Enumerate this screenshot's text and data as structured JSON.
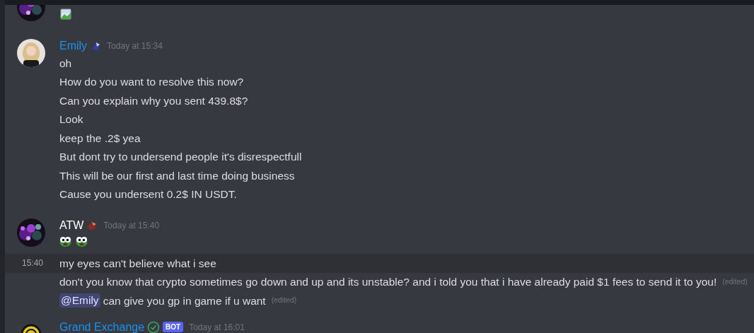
{
  "messages": [
    {
      "kind": "image"
    },
    {
      "kind": "group",
      "author": "Emily",
      "color": "#1a91f0",
      "time": "Today at 15:34",
      "lines": [
        {
          "text": "oh",
          "edited": false
        },
        {
          "text": "How do you want to resolve this now?",
          "edited": false
        },
        {
          "text": "Can you explain why you sent 439.8$?",
          "edited": false
        },
        {
          "text": "Look",
          "edited": false
        },
        {
          "text": "keep the .2$ yea",
          "edited": false
        },
        {
          "text": "But dont try to undersend people it's disrespectfull",
          "edited": false
        },
        {
          "text": "This will be our first and last time doing business",
          "edited": false
        },
        {
          "text": "Cause you undersent 0.2$ IN USDT.",
          "edited": false
        }
      ]
    },
    {
      "kind": "group",
      "author": "ATW",
      "color": "#ffffff",
      "time": "Today at 15:40",
      "emojis": [
        {
          "kind": "frog"
        },
        {
          "kind": "frog"
        }
      ]
    },
    {
      "kind": "continuation",
      "hovered": true,
      "time": "15:40",
      "lines": [
        {
          "text": "my eyes can't believe what i see",
          "edited": false
        },
        {
          "text": "don't you know that crypto sometimes go down and up and its unstable? and i told you that i have already paid $1 fees to send it to you!",
          "edited": true,
          "edited_label": "(edited)"
        },
        {
          "mention": "@Emily",
          "text": "can give you gp in game if u want",
          "edited": true,
          "edited_label": "(edited)"
        }
      ]
    },
    {
      "kind": "group",
      "author": "Grand Exchange",
      "color": "#1a91f0",
      "verified": true,
      "tag": "BOT",
      "time": "Today at 16:01"
    }
  ]
}
